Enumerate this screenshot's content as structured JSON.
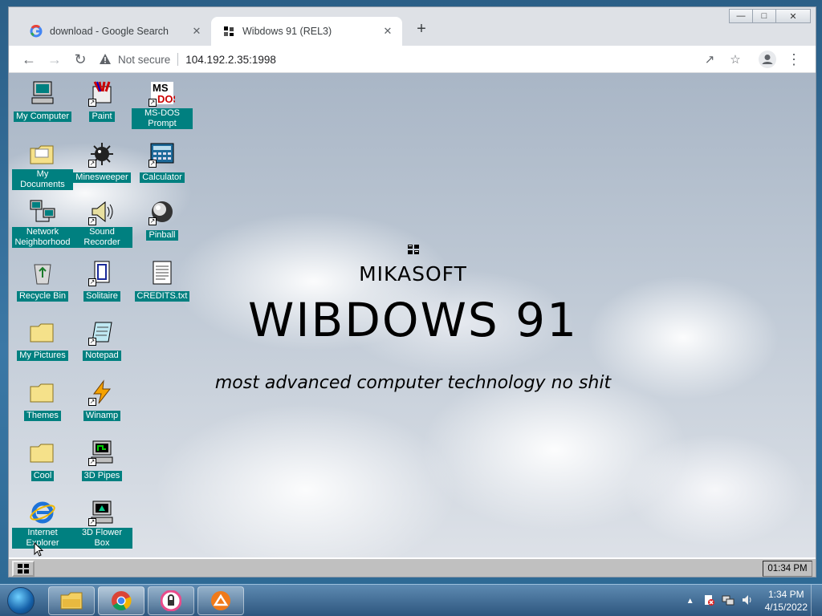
{
  "browser": {
    "tabs": [
      {
        "title": "download - Google Search",
        "favicon": "google-g-icon"
      },
      {
        "title": "Wibdows 91 (REL3)",
        "favicon": "wibdows-flag-icon"
      }
    ],
    "security_label": "Not secure",
    "url": "104.192.2.35:1998"
  },
  "desktop": {
    "icons": [
      {
        "label": "My Computer",
        "icon": "computer-icon"
      },
      {
        "label": "Paint",
        "icon": "paint-icon"
      },
      {
        "label": "MS-DOS Prompt",
        "icon": "msdos-icon"
      },
      {
        "label": "My Documents",
        "icon": "folder-icon"
      },
      {
        "label": "Minesweeper",
        "icon": "minesweeper-icon"
      },
      {
        "label": "Calculator",
        "icon": "calculator-icon"
      },
      {
        "label": "Network Neighborhood",
        "icon": "network-icon"
      },
      {
        "label": "Sound Recorder",
        "icon": "sound-recorder-icon"
      },
      {
        "label": "Pinball",
        "icon": "pinball-icon"
      },
      {
        "label": "Recycle Bin",
        "icon": "recycle-bin-icon"
      },
      {
        "label": "Solitaire",
        "icon": "solitaire-icon"
      },
      {
        "label": "CREDITS.txt",
        "icon": "text-file-icon"
      },
      {
        "label": "My Pictures",
        "icon": "folder-icon"
      },
      {
        "label": "Notepad",
        "icon": "notepad-icon"
      },
      {
        "label": "Themes",
        "icon": "folder-icon"
      },
      {
        "label": "Winamp",
        "icon": "winamp-icon"
      },
      {
        "label": "Cool",
        "icon": "folder-icon"
      },
      {
        "label": "3D Pipes",
        "icon": "screensaver-icon"
      },
      {
        "label": "Internet Explorer",
        "icon": "ie-icon"
      },
      {
        "label": "3D Flower Box",
        "icon": "screensaver-icon"
      }
    ],
    "brand": {
      "company": "MIKASOFT",
      "title": "WIBDOWS 91",
      "tagline": "most advanced computer technology no shit"
    },
    "taskbar": {
      "clock": "01:34 PM"
    }
  },
  "host_taskbar": {
    "time": "1:34 PM",
    "date": "4/15/2022"
  },
  "colors": {
    "label_bg": "#008080",
    "chrome_frame": "#dee1e6",
    "win91_gray": "#c0c0c0"
  }
}
